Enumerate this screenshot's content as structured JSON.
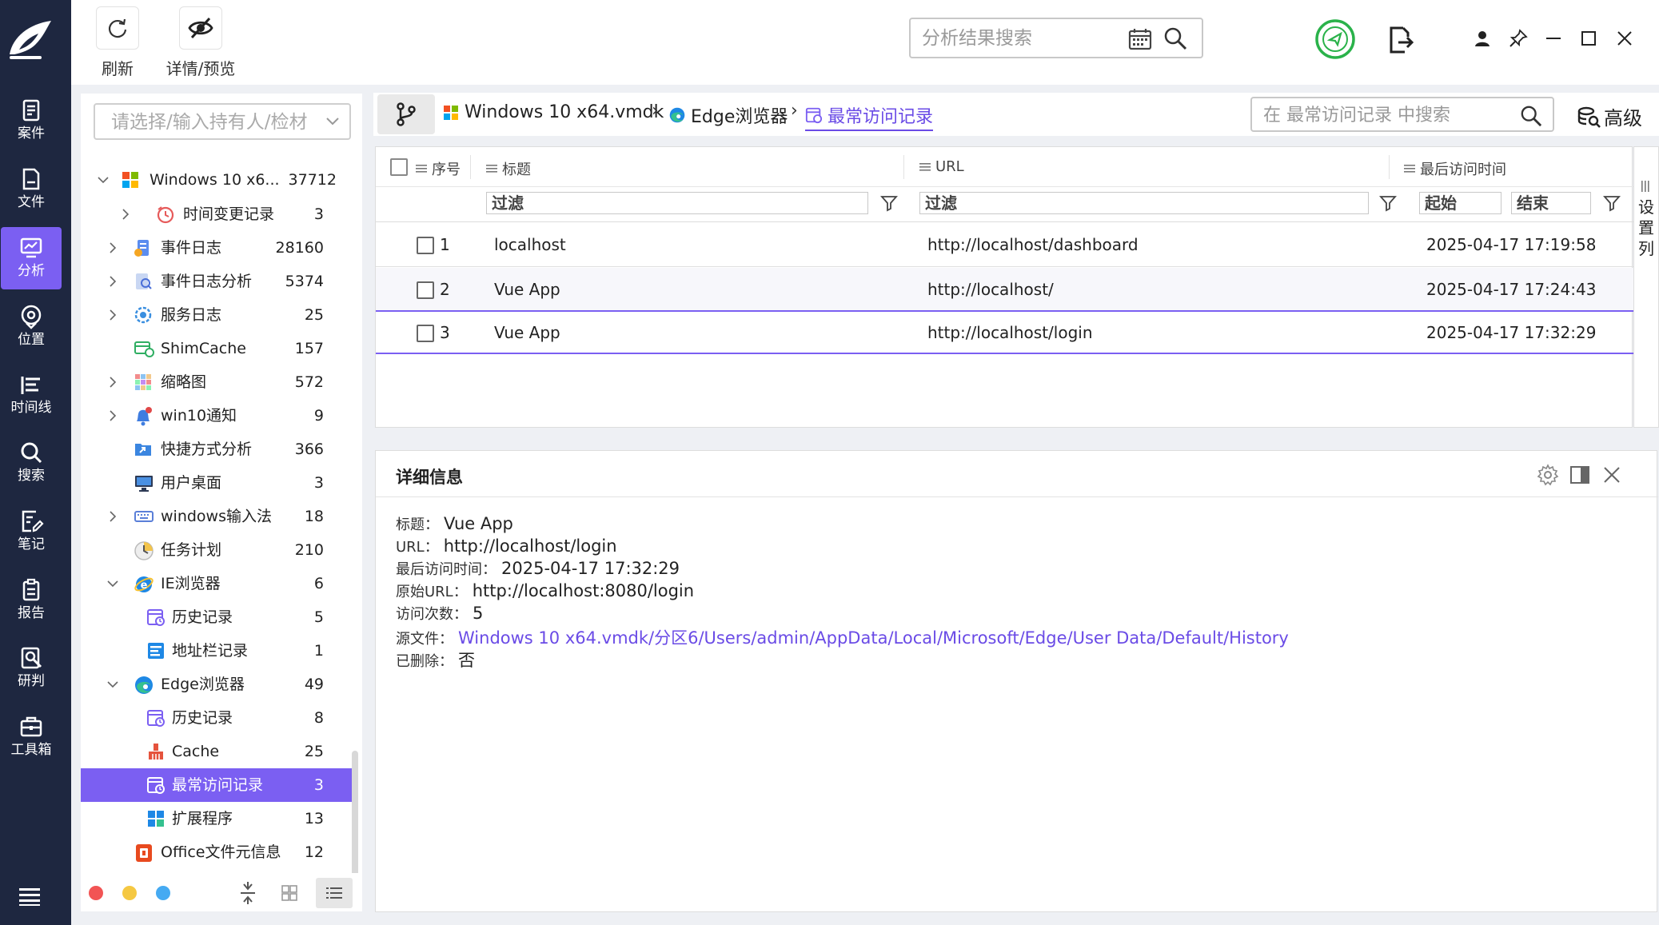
{
  "toolbar": {
    "refresh_label": "刷新",
    "detail_preview_label": "详情/预览",
    "search_placeholder": "分析结果搜索"
  },
  "nav": {
    "items": [
      {
        "label": "案件",
        "icon": "case-icon"
      },
      {
        "label": "文件",
        "icon": "file-icon"
      },
      {
        "label": "分析",
        "icon": "analysis-icon",
        "active": true
      },
      {
        "label": "位置",
        "icon": "location-icon"
      },
      {
        "label": "时间线",
        "icon": "timeline-icon"
      },
      {
        "label": "搜索",
        "icon": "search-icon"
      },
      {
        "label": "笔记",
        "icon": "notes-icon"
      },
      {
        "label": "报告",
        "icon": "report-icon"
      },
      {
        "label": "研判",
        "icon": "research-icon"
      },
      {
        "label": "工具箱",
        "icon": "toolbox-icon"
      }
    ]
  },
  "owner_select": {
    "placeholder": "请选择/输入持有人/检材"
  },
  "tree": {
    "items": [
      {
        "label": "Windows 10 x6...",
        "count": "37712"
      },
      {
        "label": "时间变更记录",
        "count": "3"
      },
      {
        "label": "事件日志",
        "count": "28160"
      },
      {
        "label": "事件日志分析",
        "count": "5374"
      },
      {
        "label": "服务日志",
        "count": "25"
      },
      {
        "label": "ShimCache",
        "count": "157"
      },
      {
        "label": "缩略图",
        "count": "572"
      },
      {
        "label": "win10通知",
        "count": "9"
      },
      {
        "label": "快捷方式分析",
        "count": "366"
      },
      {
        "label": "用户桌面",
        "count": "3"
      },
      {
        "label": "windows输入法",
        "count": "18"
      },
      {
        "label": "任务计划",
        "count": "210"
      },
      {
        "label": "IE浏览器",
        "count": "6"
      },
      {
        "label": "历史记录",
        "count": "5"
      },
      {
        "label": "地址栏记录",
        "count": "1"
      },
      {
        "label": "Edge浏览器",
        "count": "49"
      },
      {
        "label": "历史记录",
        "count": "8"
      },
      {
        "label": "Cache",
        "count": "25"
      },
      {
        "label": "最常访问记录",
        "count": "3",
        "selected": true
      },
      {
        "label": "扩展程序",
        "count": "13"
      },
      {
        "label": "Office文件元信息",
        "count": "12"
      }
    ]
  },
  "breadcrumb": {
    "items": [
      "Windows 10 x64.vmdk",
      "Edge浏览器",
      "最常访问记录"
    ],
    "search_placeholder": "在 最常访问记录 中搜索",
    "advanced_label": "高级"
  },
  "table": {
    "headers": {
      "index": "序号",
      "title": "标题",
      "url": "URL",
      "last_visit": "最后访问时间"
    },
    "filter_text": "过滤",
    "start_label": "起始",
    "end_label": "结束",
    "rows": [
      {
        "index": "1",
        "title": "localhost",
        "url": "http://localhost/dashboard",
        "last_visit": "2025-04-17 17:19:58"
      },
      {
        "index": "2",
        "title": "Vue App",
        "url": "http://localhost/",
        "last_visit": "2025-04-17 17:24:43"
      },
      {
        "index": "3",
        "title": "Vue App",
        "url": "http://localhost/login",
        "last_visit": "2025-04-17 17:32:29"
      }
    ],
    "set_columns_label": "设置列"
  },
  "detail": {
    "title": "详细信息",
    "fields": [
      {
        "label": "标题：",
        "value": "Vue App"
      },
      {
        "label": "URL：",
        "value": "http://localhost/login"
      },
      {
        "label": "最后访问时间：",
        "value": "2025-04-17 17:32:29"
      },
      {
        "label": "原始URL：",
        "value": "http://localhost:8080/login"
      },
      {
        "label": "访问次数：",
        "value": "5"
      },
      {
        "label": "源文件：",
        "value": "Windows 10 x64.vmdk/分区6/Users/admin/AppData/Local/Microsoft/Edge/User Data/Default/History",
        "link": true
      },
      {
        "label": "已删除：",
        "value": "否"
      }
    ]
  },
  "colors": {
    "accent": "#7b5ff2",
    "nav_bg": "#1e2740",
    "link": "#6a4be6",
    "status_ok": "#2ab24a"
  }
}
